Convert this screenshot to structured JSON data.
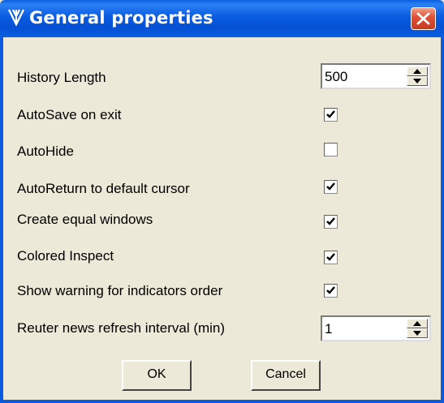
{
  "window": {
    "title": "General properties",
    "app_icon": "tv-signal-icon",
    "close_icon": "close-icon"
  },
  "settings": {
    "history_length": {
      "label": "History Length",
      "value": "500"
    },
    "autosave_on_exit": {
      "label": "AutoSave on exit",
      "checked": true
    },
    "autohide": {
      "label": "AutoHide",
      "checked": false
    },
    "autoreturn_cursor": {
      "label": "AutoReturn to default cursor",
      "checked": true
    },
    "equal_windows": {
      "label": "Create equal windows",
      "checked": true
    },
    "colored_inspect": {
      "label": "Colored Inspect",
      "checked": true
    },
    "indicator_order_warning": {
      "label": "Show warning for indicators order",
      "checked": true
    },
    "reuter_refresh": {
      "label": "Reuter news refresh interval (min)",
      "value": "1"
    }
  },
  "buttons": {
    "ok": "OK",
    "cancel": "Cancel"
  },
  "colors": {
    "titlebar": "#0a5be0",
    "close_button": "#e2533a",
    "dialog_background": "#ece9d8"
  }
}
